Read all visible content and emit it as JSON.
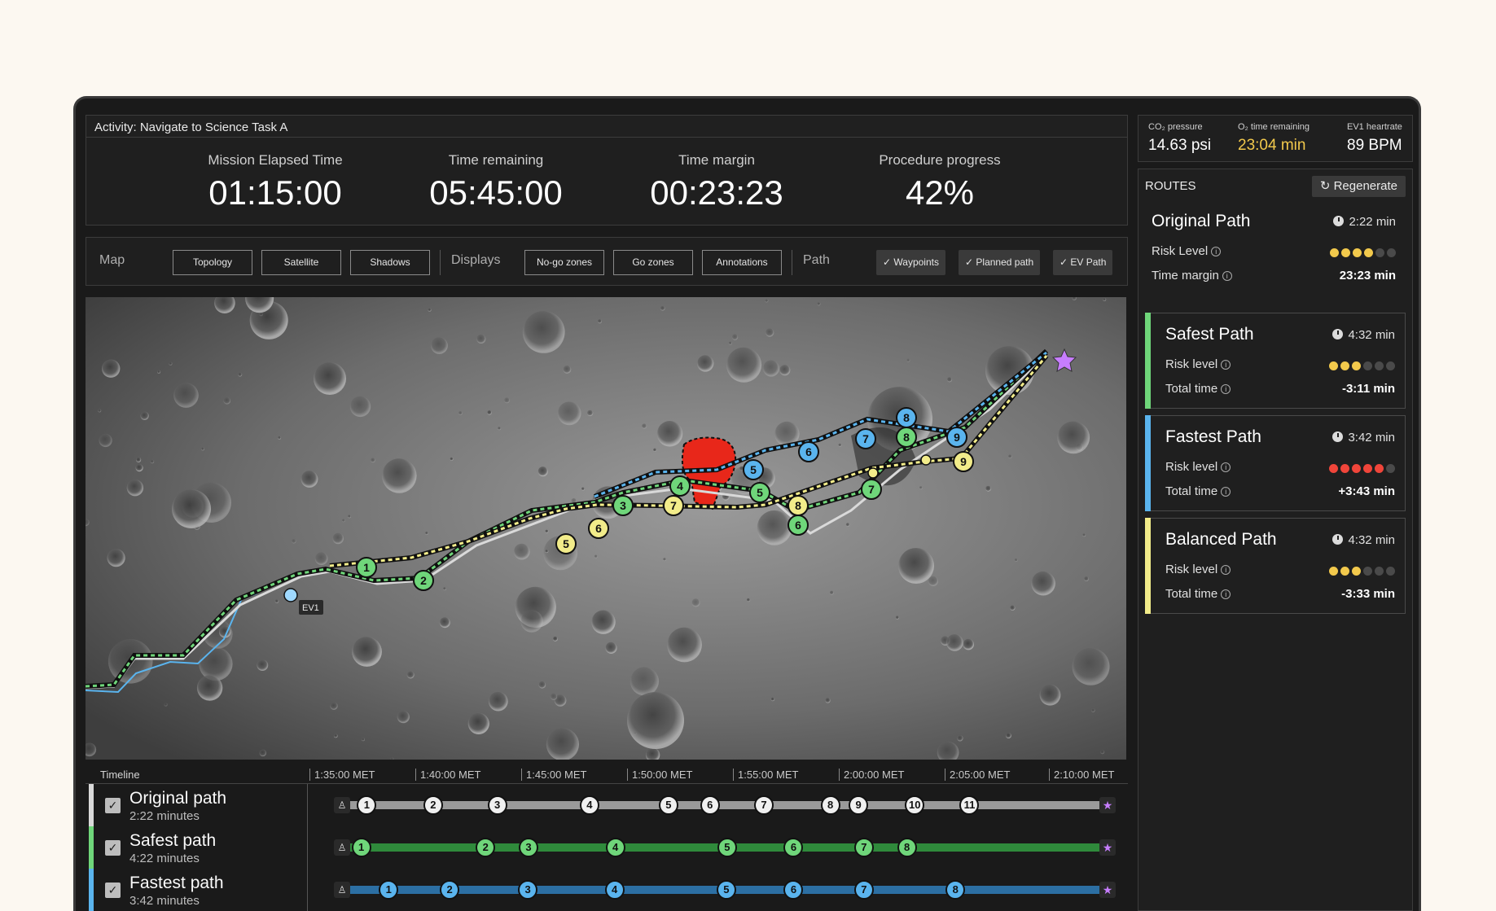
{
  "activity": "Activity: Navigate to Science Task A",
  "metrics": [
    {
      "label": "Mission Elapsed Time",
      "value": "01:15:00"
    },
    {
      "label": "Time remaining",
      "value": "05:45:00"
    },
    {
      "label": "Time margin",
      "value": "00:23:23"
    },
    {
      "label": "Procedure progress",
      "value": "42%"
    }
  ],
  "toolbar": {
    "map_label": "Map",
    "map_buttons": [
      "Topology",
      "Satellite",
      "Shadows"
    ],
    "displays_label": "Displays",
    "display_buttons": [
      "No-go zones",
      "Go zones",
      "Annotations"
    ],
    "path_label": "Path",
    "path_toggles": [
      "Waypoints",
      "Planned path",
      "EV Path"
    ],
    "check_glyph": "✓"
  },
  "map": {
    "ev_label": "EV1",
    "colors": {
      "safe": "#6fd67a",
      "fast": "#5ab4ee",
      "balanced": "#f2ec8a",
      "original": "#d9d9d9",
      "nogo": "#e8271a",
      "target": "#c77dff"
    }
  },
  "timeline": {
    "title": "Timeline",
    "ticks": [
      "1:35:00 MET",
      "1:40:00 MET",
      "1:45:00 MET",
      "1:50:00 MET",
      "1:55:00 MET",
      "2:00:00 MET",
      "2:05:00 MET",
      "2:10:00 MET"
    ],
    "start_icon": "♙",
    "end_icon": "★",
    "rows": [
      {
        "name": "Original path",
        "sub": "2:22 minutes",
        "color": "#d9d9d9",
        "bar": "#9a9a9a",
        "nodes": [
          "1",
          "2",
          "3",
          "4",
          "5",
          "6",
          "7",
          "8",
          "9",
          "10",
          "11"
        ],
        "positions": [
          0.042,
          0.127,
          0.209,
          0.327,
          0.428,
          0.481,
          0.55,
          0.635,
          0.671,
          0.743,
          0.813
        ]
      },
      {
        "name": "Safest path",
        "sub": "4:22 minutes",
        "color": "#6fd67a",
        "bar": "#2f8a3b",
        "nodes": [
          "1",
          "2",
          "3",
          "4",
          "5",
          "6",
          "7",
          "8"
        ],
        "positions": [
          0.035,
          0.194,
          0.249,
          0.36,
          0.503,
          0.588,
          0.678,
          0.733
        ]
      },
      {
        "name": "Fastest path",
        "sub": "3:42 minutes",
        "color": "#5ab4ee",
        "bar": "#2c6fa3",
        "nodes": [
          "1",
          "2",
          "3",
          "4",
          "5",
          "6",
          "7",
          "8"
        ],
        "positions": [
          0.07,
          0.148,
          0.248,
          0.359,
          0.502,
          0.588,
          0.678,
          0.795
        ]
      }
    ]
  },
  "vitals": [
    {
      "label": "CO₂ pressure",
      "value": "14.63 psi",
      "color": "#ffffff"
    },
    {
      "label": "O₂ time remaining",
      "value": "23:04 min",
      "color": "#f2c94c"
    },
    {
      "label": "EV1 heartrate",
      "value": "89 BPM",
      "color": "#ffffff"
    }
  ],
  "routes": {
    "title": "ROUTES",
    "regenerate": "Regenerate",
    "regen_icon": "↻",
    "info_glyph": "i",
    "cards": [
      {
        "name": "Original Path",
        "time": "2:22 min",
        "row1": "Risk Level",
        "row2": "Time margin",
        "row2_value": "23:23 min",
        "risk": 4,
        "risk_color": "#f2c94c",
        "accent": null
      },
      {
        "name": "Safest Path",
        "time": "4:32 min",
        "row1": "Risk level",
        "row2": "Total time",
        "row2_value": "-3:11 min",
        "risk": 3,
        "risk_color": "#f2c94c",
        "accent": "#6fd67a"
      },
      {
        "name": "Fastest Path",
        "time": "3:42 min",
        "row1": "Risk level",
        "row2": "Total time",
        "row2_value": "+3:43 min",
        "risk": 5,
        "risk_color": "#f0453a",
        "accent": "#5ab4ee"
      },
      {
        "name": "Balanced Path",
        "time": "4:32 min",
        "row1": "Risk level",
        "row2": "Total time",
        "row2_value": "-3:33 min",
        "risk": 3,
        "risk_color": "#f2c94c",
        "accent": "#f2ec8a"
      }
    ]
  }
}
